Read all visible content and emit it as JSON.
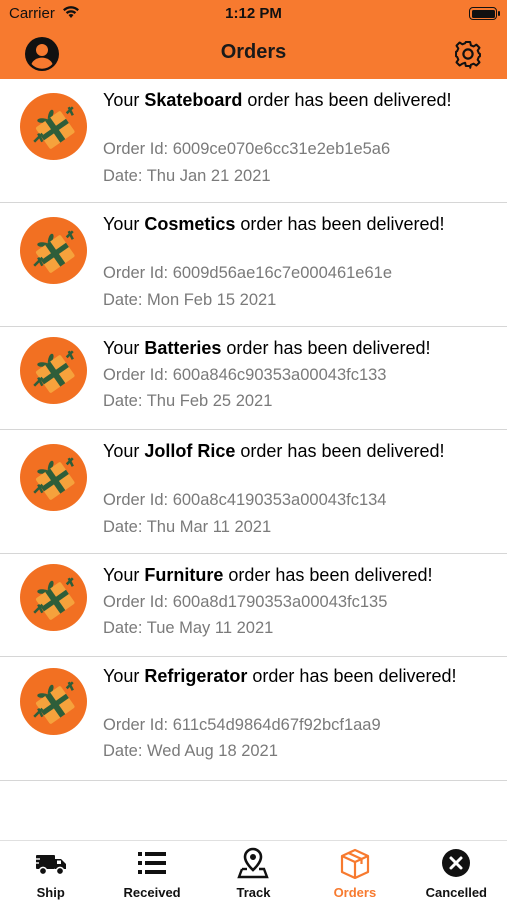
{
  "status_bar": {
    "carrier": "Carrier",
    "time": "1:12 PM"
  },
  "header": {
    "title": "Orders",
    "left_icon": "profile-icon",
    "right_icon": "gear-icon"
  },
  "colors": {
    "accent": "#f77a2f",
    "secondary_text": "#7a7a7a"
  },
  "orders": [
    {
      "prefix": "Your ",
      "item": "Skateboard",
      "suffix": " order has been delivered!",
      "order_id": "Order Id: 6009ce070e6cc31e2eb1e5a6",
      "date": "Date: Thu Jan 21 2021"
    },
    {
      "prefix": "Your ",
      "item": "Cosmetics",
      "suffix": " order has been delivered!",
      "order_id": "Order Id: 6009d56ae16c7e000461e61e",
      "date": "Date: Mon Feb 15 2021"
    },
    {
      "prefix": "Your ",
      "item": "Batteries",
      "suffix": " order has been delivered!",
      "order_id": "Order Id: 600a846c90353a00043fc133",
      "date": "Date: Thu Feb 25 2021"
    },
    {
      "prefix": "Your ",
      "item": "Jollof Rice",
      "suffix": " order has been delivered!",
      "order_id": "Order Id: 600a8c4190353a00043fc134",
      "date": "Date: Thu Mar 11 2021"
    },
    {
      "prefix": "Your ",
      "item": "Furniture",
      "suffix": " order has been delivered!",
      "order_id": "Order Id: 600a8d1790353a00043fc135",
      "date": "Date: Tue May 11 2021"
    },
    {
      "prefix": "Your ",
      "item": "Refrigerator",
      "suffix": " order has been delivered!",
      "order_id": "Order Id: 611c54d9864d67f92bcf1aa9",
      "date": "Date: Wed Aug 18 2021"
    }
  ],
  "tabs": [
    {
      "label": "Ship",
      "icon": "truck-icon",
      "active": false
    },
    {
      "label": "Received",
      "icon": "list-icon",
      "active": false
    },
    {
      "label": "Track",
      "icon": "map-pin-icon",
      "active": false
    },
    {
      "label": "Orders",
      "icon": "box-icon",
      "active": true
    },
    {
      "label": "Cancelled",
      "icon": "cancel-icon",
      "active": false
    }
  ]
}
